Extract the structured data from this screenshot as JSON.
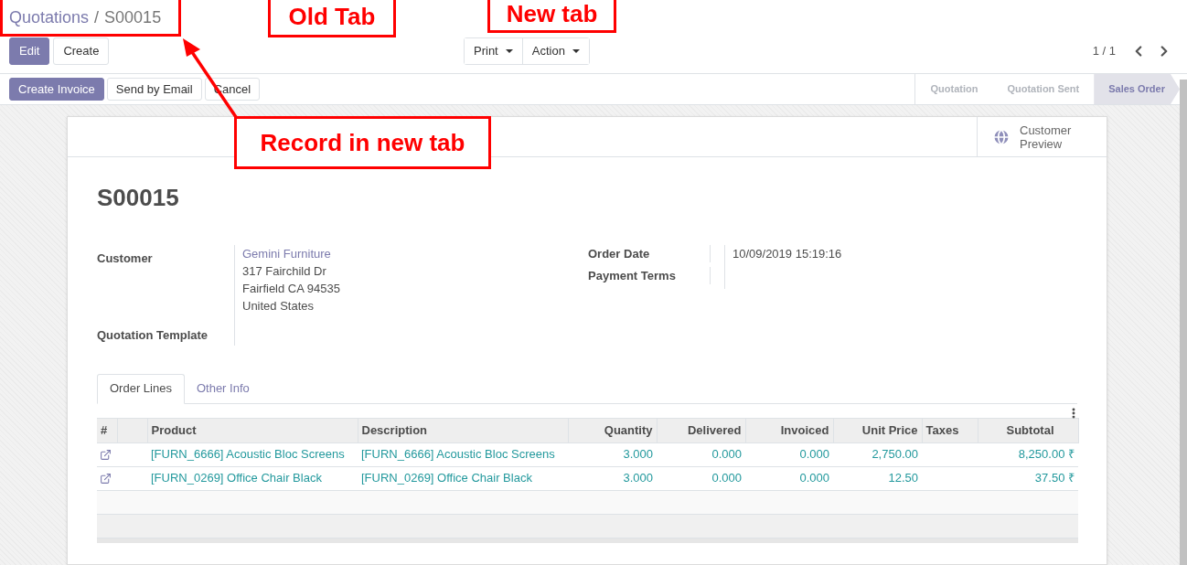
{
  "breadcrumb": {
    "parent": "Quotations",
    "separator": "/",
    "current": "S00015"
  },
  "control_buttons": [
    {
      "label": "Edit",
      "kind": "primary"
    },
    {
      "label": "Create",
      "kind": "secondary"
    }
  ],
  "dropdowns": [
    {
      "label": "Print"
    },
    {
      "label": "Action"
    }
  ],
  "pager": "1 / 1",
  "header_buttons": [
    {
      "label": "Create Invoice",
      "kind": "primary"
    },
    {
      "label": "Send by Email",
      "kind": "secondary"
    },
    {
      "label": "Cancel",
      "kind": "secondary"
    }
  ],
  "status_bar": [
    {
      "label": "Quotation",
      "selected": false
    },
    {
      "label": "Quotation Sent",
      "selected": false
    },
    {
      "label": "Sales Order",
      "selected": true
    }
  ],
  "smart_button": {
    "label": "Customer Preview"
  },
  "title": "S00015",
  "fields_left": [
    {
      "label": "Customer",
      "link": "Gemini Furniture",
      "lines": [
        "317 Fairchild Dr",
        "Fairfield CA 94535",
        "United States"
      ]
    },
    {
      "label": "Quotation Template"
    }
  ],
  "fields_right": [
    {
      "label": "Order Date",
      "value": "10/09/2019 15:19:16"
    },
    {
      "label": "Payment Terms"
    }
  ],
  "tabs": [
    {
      "label": "Order Lines",
      "selected": true
    },
    {
      "label": "Other Info",
      "selected": false
    }
  ],
  "table": {
    "columns": [
      "#",
      "Product",
      "Description",
      "Quantity",
      "Delivered",
      "Invoiced",
      "Unit Price",
      "Taxes",
      "Subtotal"
    ],
    "rows": [
      {
        "product": "[FURN_6666] Acoustic Bloc Screens",
        "description": "[FURN_6666] Acoustic Bloc Screens",
        "quantity": "3.000",
        "delivered": "0.000",
        "invoiced": "0.000",
        "unit_price": "2,750.00",
        "subtotal": "8,250.00 ₹"
      },
      {
        "product": "[FURN_0269] Office Chair Black",
        "description": "[FURN_0269] Office Chair Black",
        "quantity": "3.000",
        "delivered": "0.000",
        "invoiced": "0.000",
        "unit_price": "12.50",
        "subtotal": "37.50 ₹"
      }
    ]
  },
  "annotations": [
    {
      "text": "Old Tab"
    },
    {
      "text": "New tab"
    },
    {
      "text": "Record in new tab"
    }
  ]
}
